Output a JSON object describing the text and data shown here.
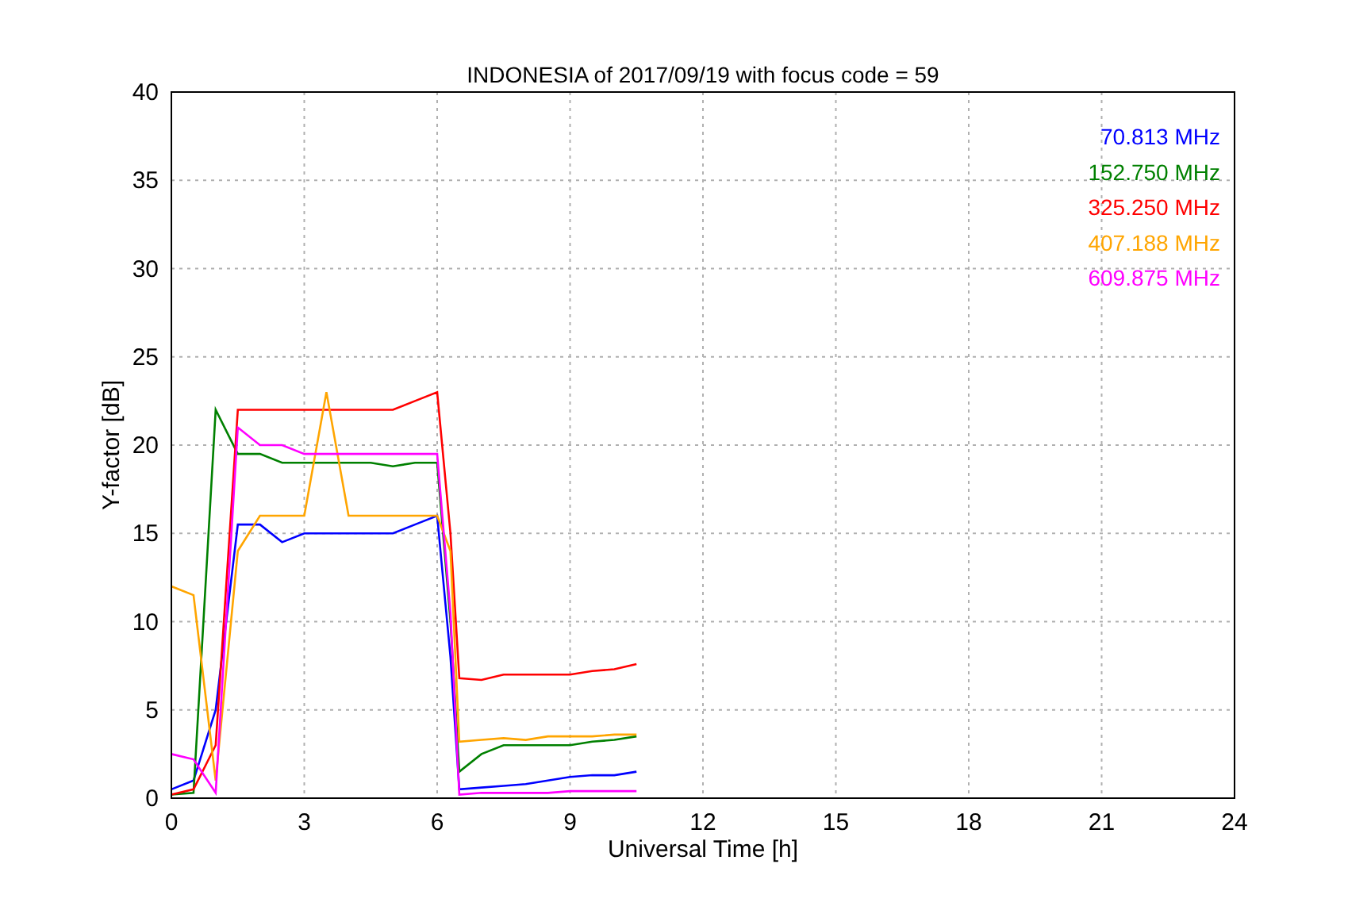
{
  "figure": {
    "chart_data": {
      "type": "line",
      "title": "INDONESIA of 2017/09/19 with focus code = 59",
      "xlabel": "Universal Time [h]",
      "ylabel": "Y-factor [dB]",
      "x": [
        0,
        0.5,
        1,
        1.5,
        2,
        2.5,
        3,
        3.5,
        4,
        4.5,
        5,
        5.5,
        6,
        6.3,
        6.5,
        7,
        7.5,
        8,
        8.5,
        9,
        9.5,
        10,
        10.5
      ],
      "series": [
        {
          "name": "70.813 MHz",
          "color": "#0000ff",
          "values": [
            0.5,
            1,
            5,
            15.5,
            15.5,
            14.5,
            15,
            15,
            15,
            15,
            15,
            15.5,
            16,
            8,
            0.5,
            0.6,
            0.7,
            0.8,
            1,
            1.2,
            1.3,
            1.3,
            1.5
          ]
        },
        {
          "name": "152.750 MHz",
          "color": "#008000",
          "values": [
            0.2,
            0.3,
            22,
            19.5,
            19.5,
            19,
            19,
            19,
            19,
            19,
            18.8,
            19,
            19,
            10,
            1.5,
            2.5,
            3,
            3,
            3,
            3,
            3.2,
            3.3,
            3.5
          ]
        },
        {
          "name": "325.250 MHz",
          "color": "#ff0000",
          "values": [
            0.2,
            0.5,
            3,
            22,
            22,
            22,
            22,
            22,
            22,
            22,
            22,
            22.5,
            23,
            15,
            6.8,
            6.7,
            7,
            7,
            7,
            7,
            7.2,
            7.3,
            7.6
          ]
        },
        {
          "name": "407.188 MHz",
          "color": "#ffa500",
          "values": [
            12,
            11.5,
            1,
            14,
            16,
            16,
            16,
            23,
            16,
            16,
            16,
            16,
            16,
            14,
            3.2,
            3.3,
            3.4,
            3.3,
            3.5,
            3.5,
            3.5,
            3.6,
            3.6
          ]
        },
        {
          "name": "609.875 MHz",
          "color": "#ff00ff",
          "values": [
            2.5,
            2.2,
            0.3,
            21,
            20,
            20,
            19.5,
            19.5,
            19.5,
            19.5,
            19.5,
            19.5,
            19.5,
            10.5,
            0.2,
            0.3,
            0.3,
            0.3,
            0.3,
            0.4,
            0.4,
            0.4,
            0.4
          ]
        }
      ],
      "xlim": [
        0,
        24
      ],
      "ylim": [
        0,
        40
      ],
      "xticks": [
        0,
        3,
        6,
        9,
        12,
        15,
        18,
        21,
        24
      ],
      "yticks": [
        0,
        5,
        10,
        15,
        20,
        25,
        30,
        35,
        40
      ],
      "grid": true
    }
  }
}
